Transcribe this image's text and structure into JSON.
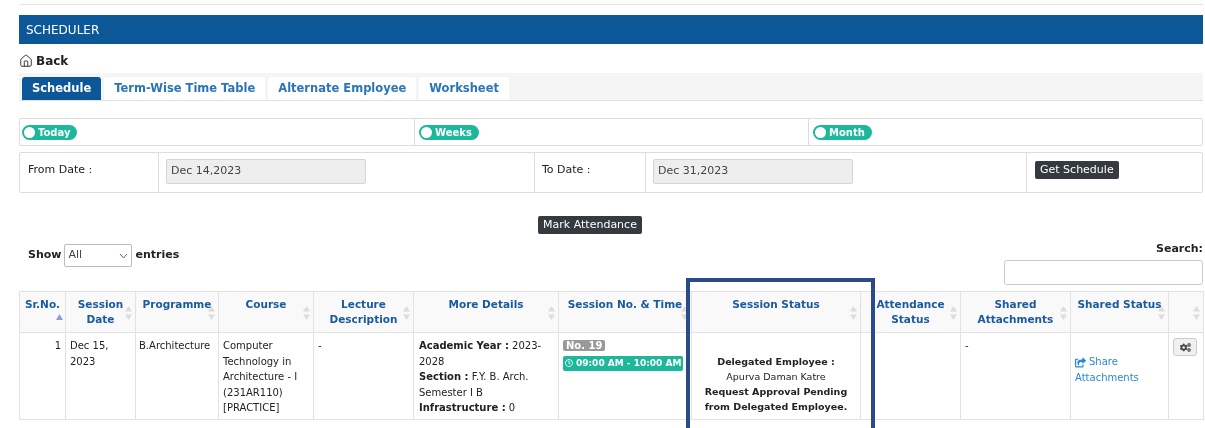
{
  "header": {
    "title": "SCHEDULER"
  },
  "back": {
    "label": "Back"
  },
  "tabs": [
    {
      "label": "Schedule",
      "selected": true
    },
    {
      "label": "Term-Wise Time Table",
      "selected": false
    },
    {
      "label": "Alternate Employee",
      "selected": false
    },
    {
      "label": "Worksheet",
      "selected": false
    }
  ],
  "periods": [
    {
      "label": "Today",
      "selected": false
    },
    {
      "label": "Weeks",
      "selected": false
    },
    {
      "label": "Month",
      "selected": false
    }
  ],
  "from_date": {
    "label": "From Date :",
    "value": "Dec 14,2023"
  },
  "to_date": {
    "label": "To Date :",
    "value": "Dec 31,2023"
  },
  "get_schedule_button": "Get Schedule",
  "mark_attendance_button": "Mark Attendance",
  "show_entries": {
    "label_before": "Show",
    "value": "All",
    "label_after": "entries"
  },
  "search": {
    "label": "Search:"
  },
  "table": {
    "columns": [
      {
        "label": "Sr.No.",
        "sorted": true
      },
      {
        "label": "Session Date",
        "sorted": false
      },
      {
        "label": "Programme",
        "sorted": false
      },
      {
        "label": "Course",
        "sorted": false
      },
      {
        "label": "Lecture Description",
        "sorted": false
      },
      {
        "label": "More Details",
        "sorted": false
      },
      {
        "label": "Session No. & Time",
        "sorted": false
      },
      {
        "label": "Session Status",
        "sorted": false
      },
      {
        "label": "Attendance Status",
        "sorted": false
      },
      {
        "label": "Shared Attachments",
        "sorted": false
      },
      {
        "label": "Shared Status",
        "sorted": false
      },
      {
        "sorted": false
      }
    ],
    "rows": [
      {
        "sr_no": "1",
        "session_date": "Dec 15, 2023",
        "programme": "B.Architecture",
        "course": "Computer Technology in Architecture - I (231AR110) [PRACTICE]",
        "lecture_description": "-",
        "more_details": [
          "**Academic Year :** 2023-2028",
          "**Section :** F.Y. B. Arch. Semester I B",
          "**Infrastructure :** 0"
        ],
        "session_no": "No. 19",
        "session_time": "09:00 AM - 10:00 AM",
        "session_status": [
          {
            "kind": "bold",
            "text": "Delegated Employee :"
          },
          {
            "kind": "plain",
            "text": "Apurva Daman Katre"
          },
          {
            "kind": "bold",
            "text": "Request Approval Pending from Delegated Employee."
          }
        ],
        "shared_attachments": "-",
        "shared_status_link": "Share Attachments"
      }
    ]
  }
}
